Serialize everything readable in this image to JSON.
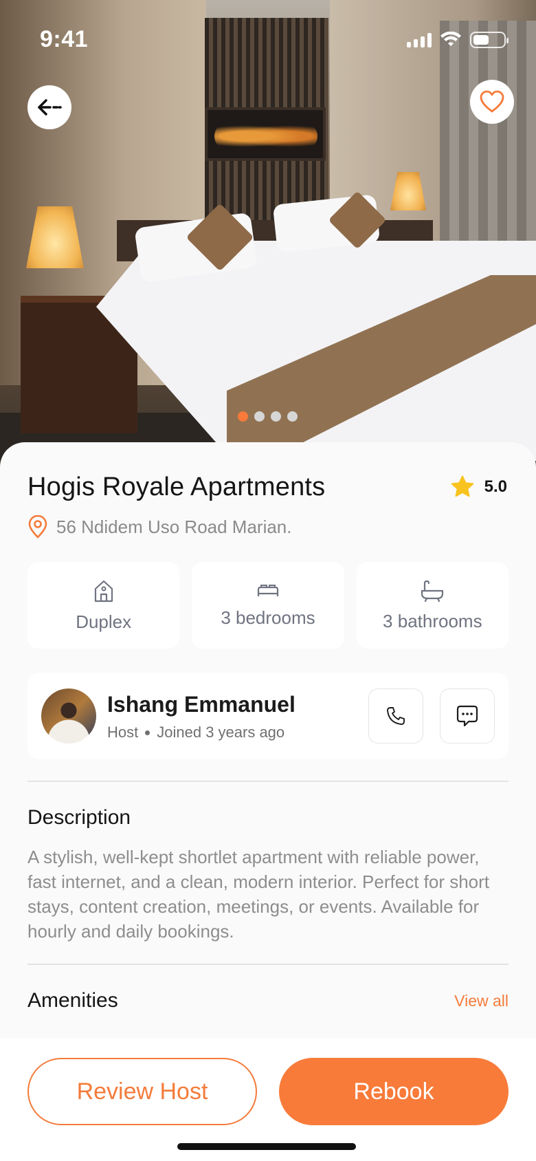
{
  "status_bar": {
    "time": "9:41"
  },
  "hero": {
    "image_alt": "Hotel bedroom with king bed, lamps and fireplace",
    "carousel_count": 4,
    "carousel_active": 0
  },
  "listing": {
    "title": "Hogis Royale Apartments",
    "rating": "5.0",
    "address": "56 Ndidem Uso Road Marian."
  },
  "features": [
    {
      "icon": "house-icon",
      "label": "Duplex"
    },
    {
      "icon": "bed-icon",
      "label": "3 bedrooms"
    },
    {
      "icon": "bathtub-icon",
      "label": "3 bathrooms"
    }
  ],
  "host": {
    "name": "Ishang Emmanuel",
    "role": "Host",
    "joined": "Joined 3 years ago"
  },
  "description": {
    "heading": "Description",
    "text": "A stylish, well-kept shortlet apartment with reliable power, fast internet, and a clean, modern interior. Perfect for short stays, content creation, meetings, or events. Available for hourly and daily bookings."
  },
  "amenities": {
    "heading": "Amenities",
    "view_all": "View all"
  },
  "actions": {
    "review_label": "Review Host",
    "rebook_label": "Rebook"
  },
  "colors": {
    "accent": "#f87b3a",
    "star": "#f8c31e",
    "text_primary": "#151515",
    "text_muted": "#8d8d8d"
  }
}
